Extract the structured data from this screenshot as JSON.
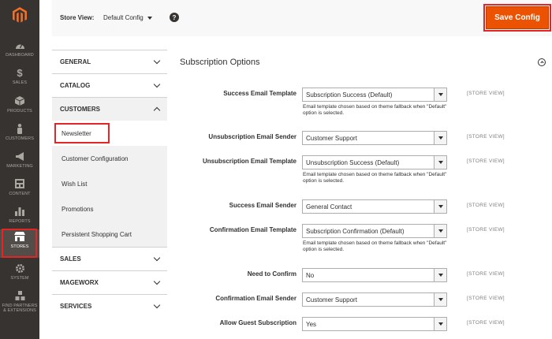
{
  "nav": {
    "items": [
      {
        "label": "DASHBOARD",
        "icon": "speedometer-icon"
      },
      {
        "label": "SALES",
        "icon": "dollar-icon"
      },
      {
        "label": "PRODUCTS",
        "icon": "box-icon"
      },
      {
        "label": "CUSTOMERS",
        "icon": "person-icon"
      },
      {
        "label": "MARKETING",
        "icon": "megaphone-icon"
      },
      {
        "label": "CONTENT",
        "icon": "layout-icon"
      },
      {
        "label": "REPORTS",
        "icon": "bar-chart-icon"
      },
      {
        "label": "STORES",
        "icon": "store-icon"
      },
      {
        "label": "SYSTEM",
        "icon": "gear-icon"
      },
      {
        "label": "FIND PARTNERS\n& EXTENSIONS",
        "icon": "cubes-icon"
      }
    ]
  },
  "header": {
    "store_view_label": "Store View:",
    "store_view_value": "Default Config",
    "help": "?",
    "save_label": "Save Config"
  },
  "sidebar": {
    "sections": [
      {
        "label": "GENERAL"
      },
      {
        "label": "CATALOG"
      },
      {
        "label": "CUSTOMERS"
      }
    ],
    "customers_items": [
      {
        "label": "Newsletter"
      },
      {
        "label": "Customer Configuration"
      },
      {
        "label": "Wish List"
      },
      {
        "label": "Promotions"
      },
      {
        "label": "Persistent Shopping Cart"
      }
    ],
    "sections_after": [
      {
        "label": "SALES"
      },
      {
        "label": "MAGEWORX"
      },
      {
        "label": "SERVICES"
      }
    ]
  },
  "main": {
    "title": "Subscription Options",
    "scope_label": "[STORE VIEW]",
    "fields": [
      {
        "label": "Success Email Template",
        "value": "Subscription Success (Default)",
        "note": "Email template chosen based on theme fallback when \"Default\" option is selected."
      },
      {
        "label": "Unsubscription Email Sender",
        "value": "Customer Support",
        "note": ""
      },
      {
        "label": "Unsubscription Email Template",
        "value": "Unsubscription Success (Default)",
        "note": "Email template chosen based on theme fallback when \"Default\" option is selected."
      },
      {
        "label": "Success Email Sender",
        "value": "General Contact",
        "note": ""
      },
      {
        "label": "Confirmation Email Template",
        "value": "Subscription Confirmation (Default)",
        "note": "Email template chosen based on theme fallback when \"Default\" option is selected."
      },
      {
        "label": "Need to Confirm",
        "value": "No",
        "note": ""
      },
      {
        "label": "Confirmation Email Sender",
        "value": "Customer Support",
        "note": ""
      },
      {
        "label": "Allow Guest Subscription",
        "value": "Yes",
        "note": ""
      }
    ]
  },
  "colors": {
    "accent": "#eb5202",
    "highlight": "#e22626",
    "nav_bg": "#373330"
  }
}
